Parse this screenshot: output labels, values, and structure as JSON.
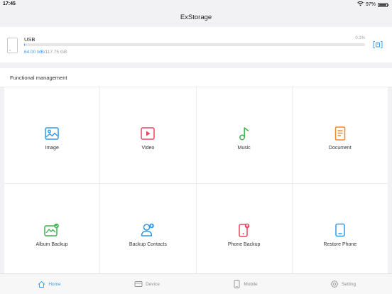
{
  "status_bar": {
    "time": "17:45",
    "battery_text": "97%",
    "battery_level": 0.97
  },
  "nav": {
    "title": "ExStorage"
  },
  "storage": {
    "name": "USB",
    "percent_label": "0.1%",
    "used": "64.00 MB",
    "separator_total": "/117.75 GB",
    "used_fraction": 0.001,
    "accent": "#3a9cf0"
  },
  "section": {
    "title": "Functional management"
  },
  "functions": [
    {
      "label": "Image",
      "icon": "image-icon",
      "color": "#2d9bef"
    },
    {
      "label": "Video",
      "icon": "video-icon",
      "color": "#e8455e"
    },
    {
      "label": "Music",
      "icon": "music-note-icon",
      "color": "#3fb24f"
    },
    {
      "label": "Document",
      "icon": "document-icon",
      "color": "#f0892a"
    },
    {
      "label": "Album Backup",
      "icon": "album-backup-icon",
      "color": "#3fb24f"
    },
    {
      "label": "Backup Contacts",
      "icon": "backup-contacts-icon",
      "color": "#2d9bef"
    },
    {
      "label": "Phone Backup",
      "icon": "phone-backup-icon",
      "color": "#e8455e"
    },
    {
      "label": "Restore Phone",
      "icon": "restore-phone-icon",
      "color": "#2d9bef"
    }
  ],
  "tabs": [
    {
      "label": "Home",
      "icon": "home-icon",
      "active": true
    },
    {
      "label": "Device",
      "icon": "device-icon",
      "active": false
    },
    {
      "label": "Mobile",
      "icon": "mobile-icon",
      "active": false
    },
    {
      "label": "Setting",
      "icon": "gear-icon",
      "active": false
    }
  ]
}
